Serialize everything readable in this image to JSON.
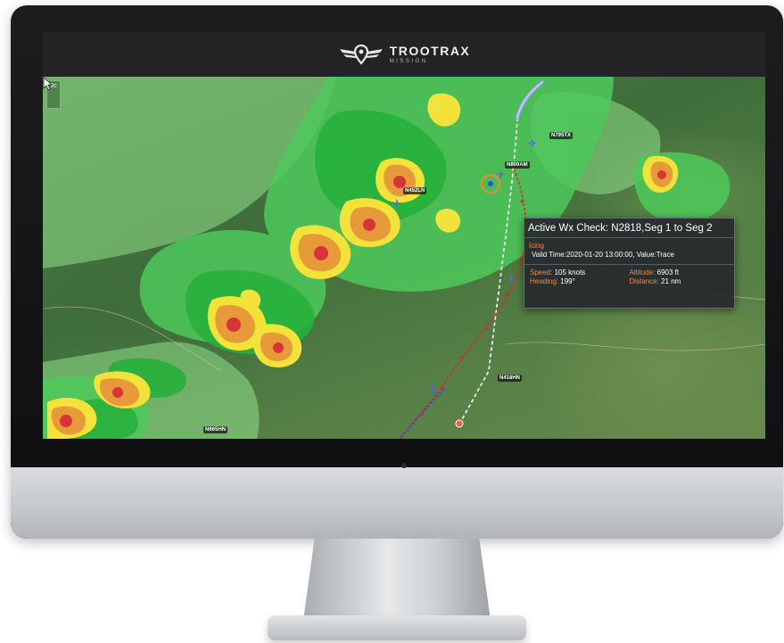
{
  "app": {
    "brand": "TrooTrax",
    "product": "MISSION",
    "logo_icon": "winged-pin-logo"
  },
  "map": {
    "zoom_button": "9c",
    "aircraft": [
      {
        "tail": "N795TX",
        "color": "#5b5bff"
      },
      {
        "tail": "N800AM",
        "color": "#5b5bff"
      },
      {
        "tail": "N452LN",
        "color": "#5b5bff"
      },
      {
        "tail": "N418HN",
        "color": "#5b5bff"
      },
      {
        "tail": "N665HN",
        "color": "#5b5bff"
      }
    ],
    "route_colors": {
      "planned": "#ffffff",
      "flown": "#d92b2b",
      "forecast": "#3a4bd9",
      "track": "#9fa0ff"
    }
  },
  "wx_panel": {
    "title": "Active Wx Check: N2818,Seg 1 to Seg 2",
    "hazard": "Icing",
    "valid": "Valid Time:2020-01-20 13:00:00, Value:Trace",
    "speed_label": "Speed:",
    "speed_value": "105 knots",
    "heading_label": "Heading:",
    "heading_value": "199°",
    "altitude_label": "Altitude:",
    "altitude_value": "6903 ft",
    "distance_label": "Distance:",
    "distance_value": "21 nm"
  },
  "colors": {
    "accent": "#e98a50",
    "radar_light": "#8fe08a",
    "radar_green": "#27b03c",
    "radar_yellow": "#f3e23a",
    "radar_orange": "#e79a3a",
    "radar_red": "#d9343a"
  }
}
